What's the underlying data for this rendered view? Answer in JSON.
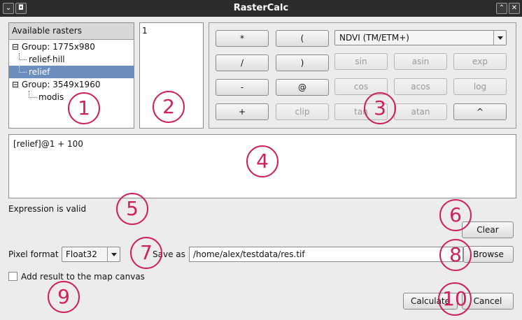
{
  "window": {
    "title": "RasterCalc",
    "left_buttons": [
      "⌄",
      "◘"
    ],
    "right_buttons": [
      "⌃",
      "✕"
    ]
  },
  "rasters": {
    "header": "Available rasters",
    "tree": [
      {
        "label": "Group: 1775x980",
        "toggle": "⊟"
      },
      {
        "label": "relief-hill"
      },
      {
        "label": "relief",
        "selected": true
      },
      {
        "label": "Group: 3549x1960",
        "toggle": "⊟"
      },
      {
        "label": "modis"
      }
    ]
  },
  "bands": {
    "items": [
      "1"
    ]
  },
  "operators": {
    "row1": [
      "*",
      "(",
      "NDVI (TM/ETM+)"
    ],
    "row2": [
      "/",
      ")",
      "sin",
      "asin",
      "exp"
    ],
    "row3": [
      "-",
      "@",
      "cos",
      "acos",
      "log"
    ],
    "row4": [
      "+",
      "clip",
      "tan",
      "atan",
      "^"
    ]
  },
  "expression": {
    "text": "[relief]@1 + 100"
  },
  "status": {
    "text": "Expression is valid"
  },
  "buttons": {
    "clear": "Clear",
    "browse": "Browse",
    "calculate": "Calculate",
    "cancel": "Cancel"
  },
  "pixel_format": {
    "label": "Pixel format",
    "value": "Float32"
  },
  "save_as": {
    "label": "Save as",
    "path": "/home/alex/testdata/res.tif"
  },
  "add_to_canvas": {
    "label": "Add result to the map canvas",
    "checked": false
  },
  "annotations": [
    "1",
    "2",
    "3",
    "4",
    "5",
    "6",
    "7",
    "8",
    "9",
    "10"
  ],
  "colors": {
    "annotation": "#d01f5d",
    "selection": "#6c8ebf",
    "titlebar": "#2b2b2b"
  }
}
